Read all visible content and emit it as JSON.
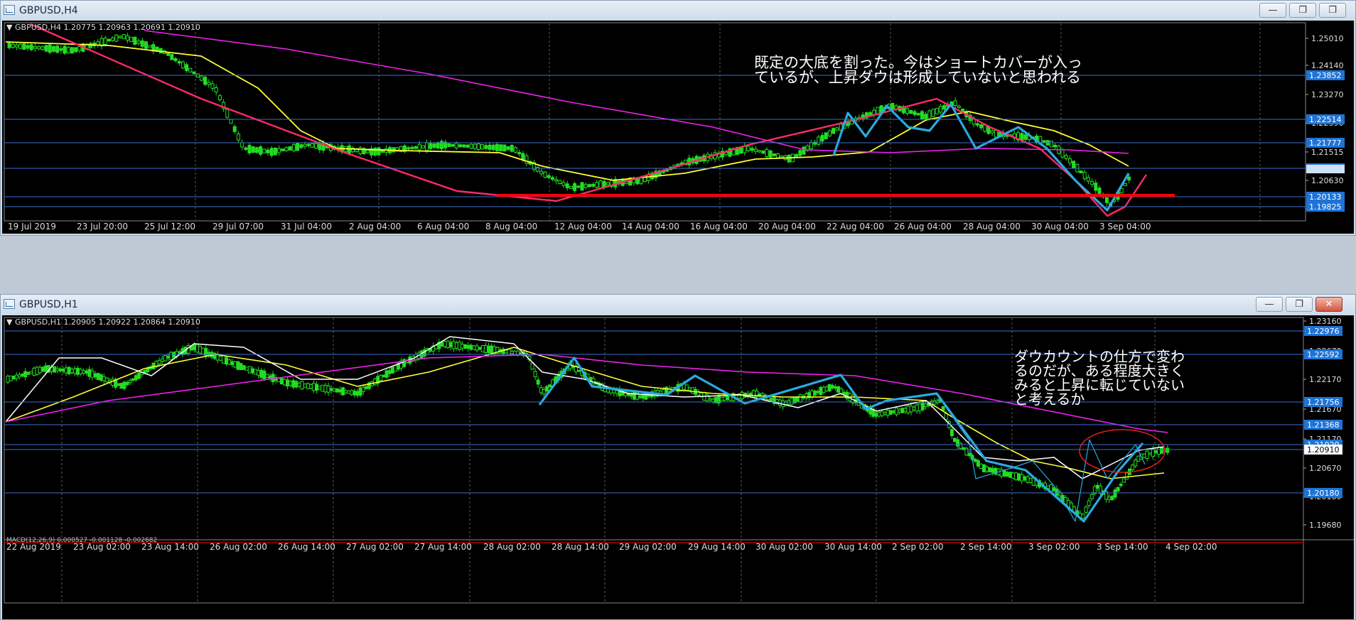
{
  "windows": [
    {
      "title": "GBPUSD,H4",
      "info": "GBPUSD,H4  1.20775 1.20963 1.20691 1.20910",
      "annotation": [
        "既定の大底を割った。今はショートカバーが入っ",
        "ているが、上昇ダウは形成していないと思われる"
      ],
      "price_ticks": [
        "1.25010",
        "1.24140",
        "1.23270",
        "1.22390",
        "1.21515",
        "1.20630",
        "1.19780"
      ],
      "price_lines": [
        {
          "label": "1.23852",
          "price": 1.23852
        },
        {
          "label": "1.22514",
          "price": 1.22514
        },
        {
          "label": "1.21777",
          "price": 1.21777
        },
        {
          "label": "1.21016",
          "price": 1.21016
        },
        {
          "label": "1.20133",
          "price": 1.20133
        },
        {
          "label": "1.19825",
          "price": 1.19825
        }
      ],
      "time_labels": [
        "19 Jul 2019",
        "23 Jul 20:00",
        "25 Jul 12:00",
        "29 Jul 07:00",
        "31 Jul 04:00",
        "2 Aug 04:00",
        "6 Aug 04:00",
        "8 Aug 04:00",
        "12 Aug 04:00",
        "14 Aug 04:00",
        "16 Aug 04:00",
        "20 Aug 04:00",
        "22 Aug 04:00",
        "26 Aug 04:00",
        "28 Aug 04:00",
        "30 Aug 04:00",
        "3 Sep 04:00"
      ]
    },
    {
      "title": "GBPUSD,H1",
      "info": "GBPUSD,H1  1.20905 1.20922 1.20864 1.20910",
      "annotation": [
        "ダウカウントの仕方で変わ",
        "るのだが、ある程度大きく",
        "みると上昇に転じていない",
        "と考えるか"
      ],
      "price_ticks": [
        "1.23160",
        "1.22670",
        "1.22170",
        "1.21670",
        "1.21170",
        "1.20670",
        "1.20180",
        "1.19680"
      ],
      "price_lines": [
        {
          "label": "1.22976",
          "price": 1.22976
        },
        {
          "label": "1.22592",
          "price": 1.22592
        },
        {
          "label": "1.21756",
          "price": 1.21756
        },
        {
          "label": "1.21368",
          "price": 1.21368
        },
        {
          "label": "1.21020",
          "price": 1.2102
        },
        {
          "label": "1.20910",
          "price": 1.2091
        },
        {
          "label": "1.20180",
          "price": 1.2018
        }
      ],
      "indicator": "MACD(12,26,9) 0.000527 -0.001128 -0.002682",
      "time_labels": [
        "22 Aug 2019",
        "23 Aug 02:00",
        "23 Aug 14:00",
        "26 Aug 02:00",
        "26 Aug 14:00",
        "27 Aug 02:00",
        "27 Aug 14:00",
        "28 Aug 02:00",
        "28 Aug 14:00",
        "29 Aug 02:00",
        "29 Aug 14:00",
        "30 Aug 02:00",
        "30 Aug 14:00",
        "2 Sep 02:00",
        "2 Sep 14:00",
        "3 Sep 02:00",
        "3 Sep 14:00",
        "4 Sep 02:00"
      ]
    }
  ],
  "buttons": {
    "minimize": "—",
    "restore": "❐",
    "close": "✕"
  },
  "colors": {
    "candle": "#22dd22",
    "grid": "#5a5a5a",
    "level_line": "#3a6fd0",
    "ma_fast": "#ffff33",
    "ma_slow": "#ee22ee",
    "ma_white": "#ffffff",
    "trend_red": "#ff2a6a",
    "zigzag": "#2aaae0",
    "support_red": "#ff0000",
    "price_tag": "#1e73d6"
  }
}
